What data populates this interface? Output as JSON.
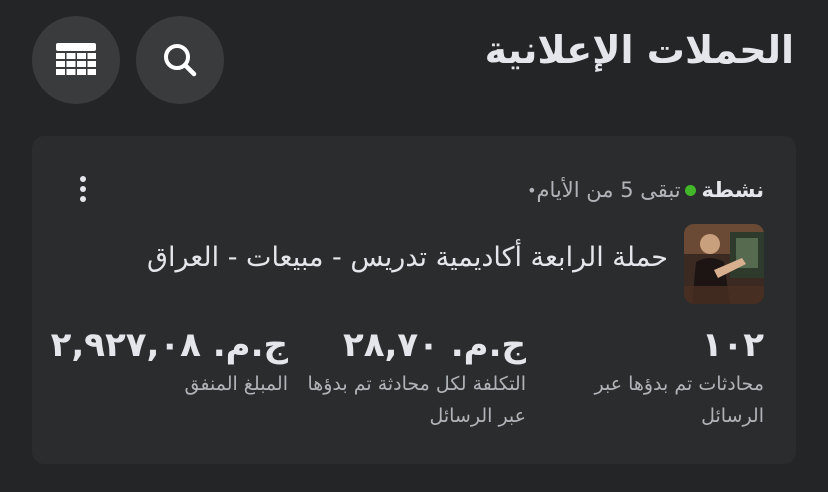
{
  "header": {
    "title": "الحملات الإعلانية",
    "search_icon": "search-icon",
    "table_icon": "table-icon"
  },
  "campaign": {
    "status": "نشطة",
    "status_color": "#42b72a",
    "remaining": "تبقى 5 من الأيام",
    "name": "حملة الرابعة أكاديمية تدريس - مبيعات - العراق",
    "more_icon": "more-vertical-icon"
  },
  "metrics": [
    {
      "value": "١٠٢",
      "label": "محادثات تم بدؤها عبر الرسائل"
    },
    {
      "value": "ج.م. ٢٨,٧٠",
      "label": "التكلفة لكل محادثة تم بدؤها عبر الرسائل"
    },
    {
      "value": "ج.م. ٢,٩٢٧,٠٨",
      "label": "المبلغ المنفق"
    }
  ],
  "colors": {
    "background": "#242526",
    "card": "#2b2c2d",
    "button": "#3a3b3c",
    "text_primary": "#e4e6eb",
    "text_secondary": "#b0b3b8"
  }
}
